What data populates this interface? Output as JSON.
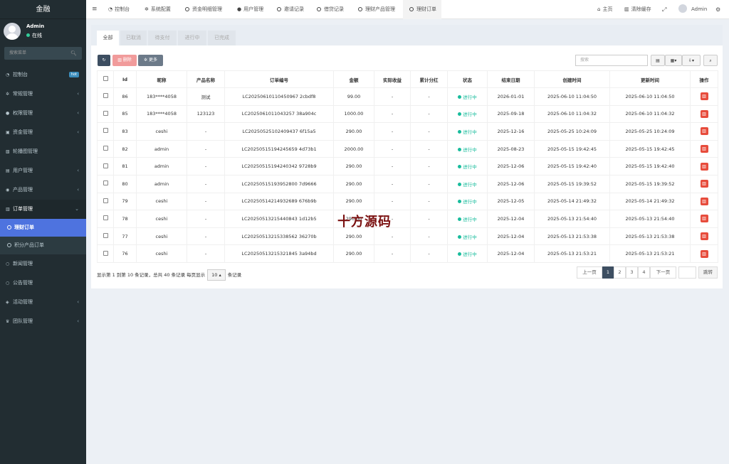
{
  "app": {
    "logo": "金融",
    "user_name": "Admin",
    "user_status": "在线",
    "search_placeholder": "搜索菜单"
  },
  "sidebar": {
    "items": [
      {
        "label": "控制台",
        "badge": "hot",
        "icon": "dashboard-icon"
      },
      {
        "label": "常规管理",
        "icon": "cogs-icon"
      },
      {
        "label": "权限管理",
        "icon": "group-icon"
      },
      {
        "label": "资金管理",
        "icon": "money-icon"
      },
      {
        "label": "轮播图管理",
        "icon": "image-icon"
      },
      {
        "label": "用户管理",
        "icon": "user-card-icon"
      },
      {
        "label": "产品管理",
        "icon": "product-icon"
      },
      {
        "label": "订单管理",
        "icon": "order-icon"
      }
    ],
    "sub_items": [
      {
        "label": "理财订单",
        "active": true
      },
      {
        "label": "积分产品订单"
      }
    ],
    "items_after": [
      {
        "label": "新闻管理"
      },
      {
        "label": "公告管理"
      },
      {
        "label": "活动管理",
        "icon": "gift-icon"
      },
      {
        "label": "团队管理",
        "icon": "trophy-icon"
      }
    ]
  },
  "topbar": {
    "tabs": [
      "控制台",
      "系统配置",
      "资金明细管理",
      "用户管理",
      "邀请记录",
      "借贷记录",
      "理财产品管理",
      "理财订单"
    ],
    "right": {
      "home": "主页",
      "clear_cache": "清除缓存",
      "user": "Admin"
    }
  },
  "filters": [
    "全部",
    "已取消",
    "待支付",
    "进行中",
    "已完成"
  ],
  "toolbar": {
    "delete": "删除",
    "more": "更多",
    "search_placeholder": "搜索"
  },
  "table": {
    "headers": [
      "Id",
      "昵称",
      "产品名称",
      "订单编号",
      "金额",
      "实际收益",
      "累计分红",
      "状态",
      "结束日期",
      "创建时间",
      "更新时间",
      "操作"
    ],
    "rows": [
      [
        "86",
        "183****4058",
        "测试",
        "LC20250610110450967 2cbdf8",
        "99.00",
        "-",
        "-",
        "进行中",
        "2026-01-01",
        "2025-06-10 11:04:50",
        "2025-06-10 11:04:50"
      ],
      [
        "85",
        "183****4058",
        "123123",
        "LC2025061011043257 38a904c",
        "1000.00",
        "-",
        "-",
        "进行中",
        "2025-09-18",
        "2025-06-10 11:04:32",
        "2025-06-10 11:04:32"
      ],
      [
        "83",
        "ceshi",
        "-",
        "LC20250525102409437 6f15a5",
        "290.00",
        "-",
        "-",
        "进行中",
        "2025-12-16",
        "2025-05-25 10:24:09",
        "2025-05-25 10:24:09"
      ],
      [
        "82",
        "admin",
        "-",
        "LC20250515194245659 4d73b1",
        "2000.00",
        "-",
        "-",
        "进行中",
        "2025-08-23",
        "2025-05-15 19:42:45",
        "2025-05-15 19:42:45"
      ],
      [
        "81",
        "admin",
        "-",
        "LC20250515194240342 9728b9",
        "290.00",
        "-",
        "-",
        "进行中",
        "2025-12-06",
        "2025-05-15 19:42:40",
        "2025-05-15 19:42:40"
      ],
      [
        "80",
        "admin",
        "-",
        "LC20250515193952800 7d9666",
        "290.00",
        "-",
        "-",
        "进行中",
        "2025-12-06",
        "2025-05-15 19:39:52",
        "2025-05-15 19:39:52"
      ],
      [
        "79",
        "ceshi",
        "-",
        "LC20250514214932689 676b9b",
        "290.00",
        "-",
        "-",
        "进行中",
        "2025-12-05",
        "2025-05-14 21:49:32",
        "2025-05-14 21:49:32"
      ],
      [
        "78",
        "ceshi",
        "-",
        "LC20250513215440843 1d12b5",
        "290.00",
        "-",
        "-",
        "进行中",
        "2025-12-04",
        "2025-05-13 21:54:40",
        "2025-05-13 21:54:40"
      ],
      [
        "77",
        "ceshi",
        "-",
        "LC20250513215338562 36270b",
        "290.00",
        "-",
        "-",
        "进行中",
        "2025-12-04",
        "2025-05-13 21:53:38",
        "2025-05-13 21:53:38"
      ],
      [
        "76",
        "ceshi",
        "-",
        "LC20250513215321845 3a94bd",
        "290.00",
        "-",
        "-",
        "进行中",
        "2025-12-04",
        "2025-05-13 21:53:21",
        "2025-05-13 21:53:21"
      ]
    ]
  },
  "footer": {
    "text_before": "显示第 1 到第 10 条记录，总共 40 条记录 每页显示",
    "page_size": "10",
    "text_after": "条记录"
  },
  "pagination": {
    "prev": "上一页",
    "pages": [
      "1",
      "2",
      "3",
      "4"
    ],
    "next": "下一页",
    "jump": "跳转"
  },
  "watermark": "十方源码",
  "colors": {
    "sidebar_bg": "#222d32",
    "active_menu": "#4e73df",
    "status_green": "#18bc9c",
    "danger": "#e74c3c",
    "refresh": "#3d4e61"
  }
}
